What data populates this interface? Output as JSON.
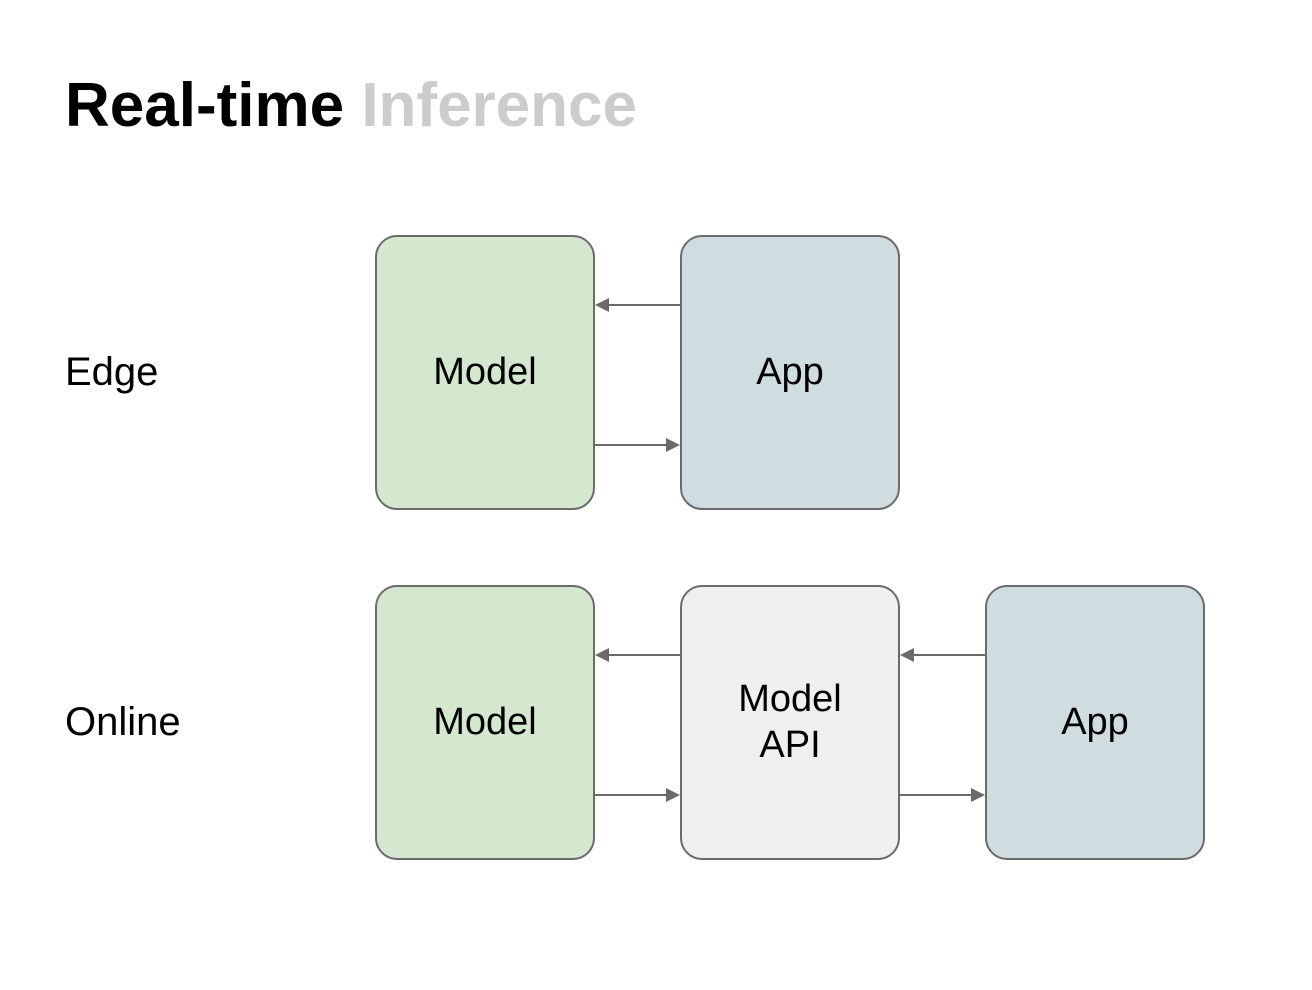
{
  "title": {
    "bold": "Real-time",
    "light": "Inference"
  },
  "rows": {
    "edge": {
      "label": "Edge",
      "boxes": {
        "model": "Model",
        "app": "App"
      }
    },
    "online": {
      "label": "Online",
      "boxes": {
        "model": "Model",
        "modelApi": "Model\nAPI",
        "app": "App"
      }
    }
  },
  "colors": {
    "green": "#d4e8d0",
    "blue": "#cfdce0",
    "grey": "#efefef",
    "border": "#6b6b6b",
    "titleLight": "#cccccc"
  }
}
